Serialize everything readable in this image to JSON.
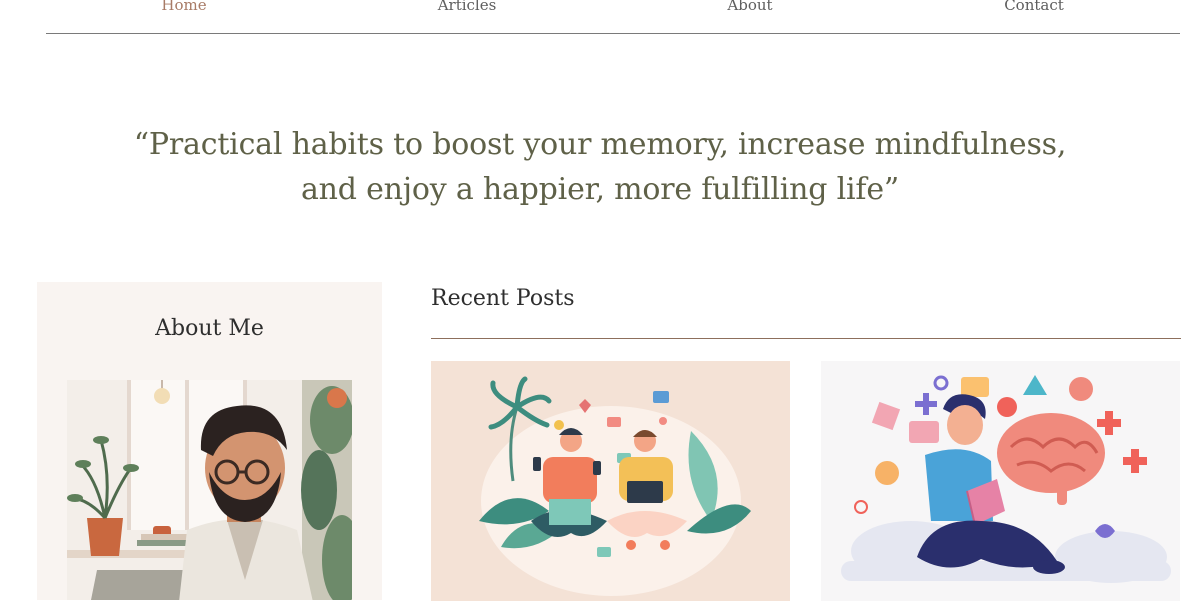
{
  "nav": {
    "items": [
      {
        "label": "Home",
        "active": true
      },
      {
        "label": "Articles",
        "active": false
      },
      {
        "label": "About",
        "active": false
      },
      {
        "label": "Contact",
        "active": false
      }
    ]
  },
  "quote": {
    "line1": "“Practical habits to boost your memory, increase mindfulness,",
    "line2": "and enjoy a happier, more fulfilling life”"
  },
  "about": {
    "title": "About Me"
  },
  "recent": {
    "title": "Recent Posts"
  },
  "colors": {
    "nav_active": "#a87b66",
    "quote": "#5f6148",
    "about_bg": "#f9f4f1",
    "rule": "#8d6f5c",
    "post1_bg": "#f4e2d6",
    "post2_bg": "#f7f6f7"
  }
}
